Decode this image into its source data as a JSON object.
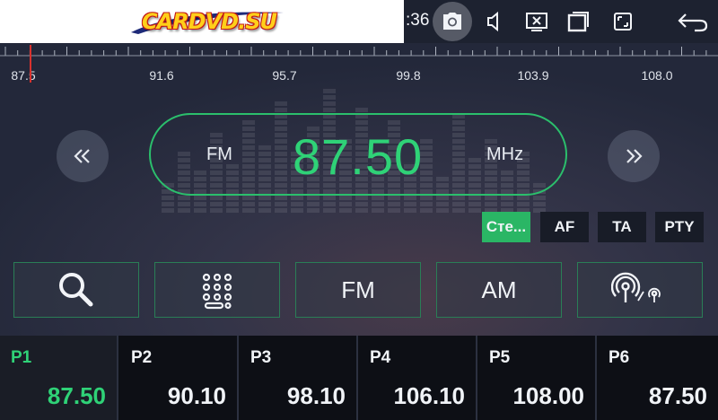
{
  "status_bar": {
    "logo_text": "CARDVD.SU",
    "clock": ":36",
    "icons": [
      "camera-icon",
      "volume-icon",
      "close-window-icon",
      "recent-apps-icon",
      "fullscreen-icon",
      "back-icon"
    ]
  },
  "scale": {
    "labels": [
      "87.5",
      "91.6",
      "95.7",
      "99.8",
      "103.9",
      "108.0"
    ],
    "marker_color": "#d9322e"
  },
  "radio": {
    "band": "FM",
    "frequency": "87.50",
    "unit": "MHz",
    "accent_color": "#2fd277"
  },
  "toggles": [
    {
      "label": "Сте...",
      "active": true
    },
    {
      "label": "AF",
      "active": false
    },
    {
      "label": "TA",
      "active": false
    },
    {
      "label": "PTY",
      "active": false
    }
  ],
  "functions": {
    "search_icon": "search-icon",
    "keypad_icon": "keypad-icon",
    "fm_label": "FM",
    "am_label": "AM",
    "broadcast_icon": "broadcast-antenna-icon"
  },
  "presets": [
    {
      "name": "P1",
      "freq": "87.50",
      "active": true
    },
    {
      "name": "P2",
      "freq": "90.10",
      "active": false
    },
    {
      "name": "P3",
      "freq": "98.10",
      "active": false
    },
    {
      "name": "P4",
      "freq": "106.10",
      "active": false
    },
    {
      "name": "P5",
      "freq": "108.00",
      "active": false
    },
    {
      "name": "P6",
      "freq": "87.50",
      "active": false
    }
  ]
}
